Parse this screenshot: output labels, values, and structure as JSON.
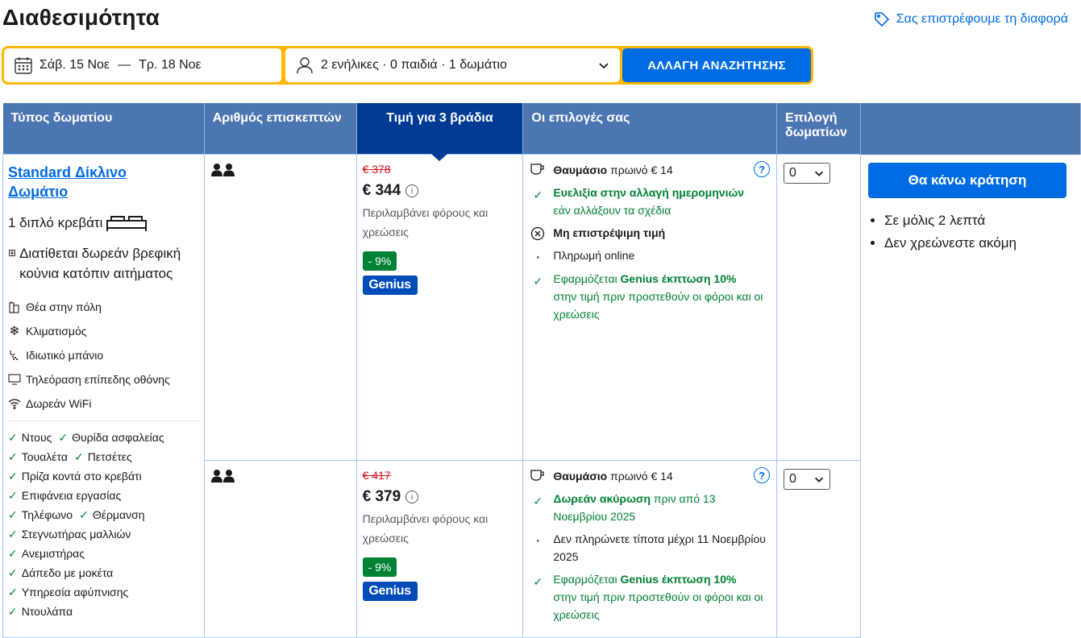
{
  "header": {
    "title": "Διαθεσιμότητα",
    "price_match": "Σας επιστρέφουμε τη διαφορά"
  },
  "search": {
    "checkin": "Σάβ. 15 Νοε",
    "dash": "—",
    "checkout": "Τρ. 18 Νοε",
    "guests": "2 ενήλικες · 0 παιδιά · 1 δωμάτιο",
    "button": "ΑΛΛΑΓΗ ΑΝΑΖΗΤΗΣΗΣ"
  },
  "table": {
    "headers": [
      "Τύπος δωματίου",
      "Αριθμός επισκεπτών",
      "Τιμή για 3 βράδια",
      "Οι επιλογές σας",
      "Επιλογή δωματίων"
    ]
  },
  "room": {
    "name_line1": "Standard Δίκλινο",
    "name_line2": "Δωμάτιο",
    "bed": "1 διπλό κρεβάτι",
    "crib": "Διατίθεται δωρεάν βρεφική κούνια κατόπιν αιτήματος",
    "facilities": [
      "Θέα στην πόλη",
      "Κλιματισμός",
      "Ιδιωτικό μπάνιο",
      "Τηλεόραση επίπεδης οθόνης",
      "Δωρεάν WiFi"
    ],
    "amenities": [
      "Ντους",
      "Θυρίδα ασφαλείας",
      "Τουαλέτα",
      "Πετσέτες",
      "Πρίζα κοντά στο κρεβάτι",
      "Επιφάνεια εργασίας",
      "Τηλέφωνο",
      "Θέρμανση",
      "Στεγνωτήρας μαλλιών",
      "Ανεμιστήρας",
      "Δάπεδο με μοκέτα",
      "Υπηρεσία αφύπνισης",
      "Ντουλάπα"
    ]
  },
  "rates": [
    {
      "old_price": "€ 378",
      "price": "€ 344",
      "includes": "Περιλαμβάνει φόρους και χρεώσεις",
      "discount": "- 9%",
      "genius": "Genius",
      "breakfast_bold": "Θαυμάσιο",
      "breakfast_rest": " πρωινό € 14",
      "flex_bold": "Ευελιξία στην αλλαγή ημερομηνιών",
      "flex_rest": "εάν αλλάξουν τα σχέδια",
      "nonref": "Μη επιστρέψιμη τιμή",
      "payment": "Πληρωμή online",
      "genius_pre": "Εφαρμόζεται ",
      "genius_bold": "Genius έκπτωση 10%",
      "genius_rest": "στην τιμή πριν προστεθούν οι φόροι και οι χρεώσεις",
      "qty": "0"
    },
    {
      "old_price": "€ 417",
      "price": "€ 379",
      "includes": "Περιλαμβάνει φόρους και χρεώσεις",
      "discount": "- 9%",
      "genius": "Genius",
      "breakfast_bold": "Θαυμάσιο",
      "breakfast_rest": " πρωινό € 14",
      "cancel_bold": "Δωρεάν ακύρωση",
      "cancel_rest": " πριν από 13 Νοεμβρίου 2025",
      "nopay": "Δεν πληρώνετε τίποτα μέχρι 11 Νοεμβρίου 2025",
      "genius_pre": "Εφαρμόζεται ",
      "genius_bold": "Genius έκπτωση 10%",
      "genius_rest": "στην τιμή πριν προστεθούν οι φόροι και οι χρεώσεις",
      "qty": "0"
    }
  ],
  "booking": {
    "button": "Θα κάνω κράτηση",
    "bullets": [
      "Σε μόλις 2 λεπτά",
      "Δεν χρεώνεστε ακόμη"
    ]
  },
  "colors": {
    "accent": "#006ce4",
    "header_bg": "#4c76b2",
    "selected_header": "#003b95",
    "search_border": "#ffb700",
    "green": "#008234",
    "old_price": "#d4111e"
  }
}
